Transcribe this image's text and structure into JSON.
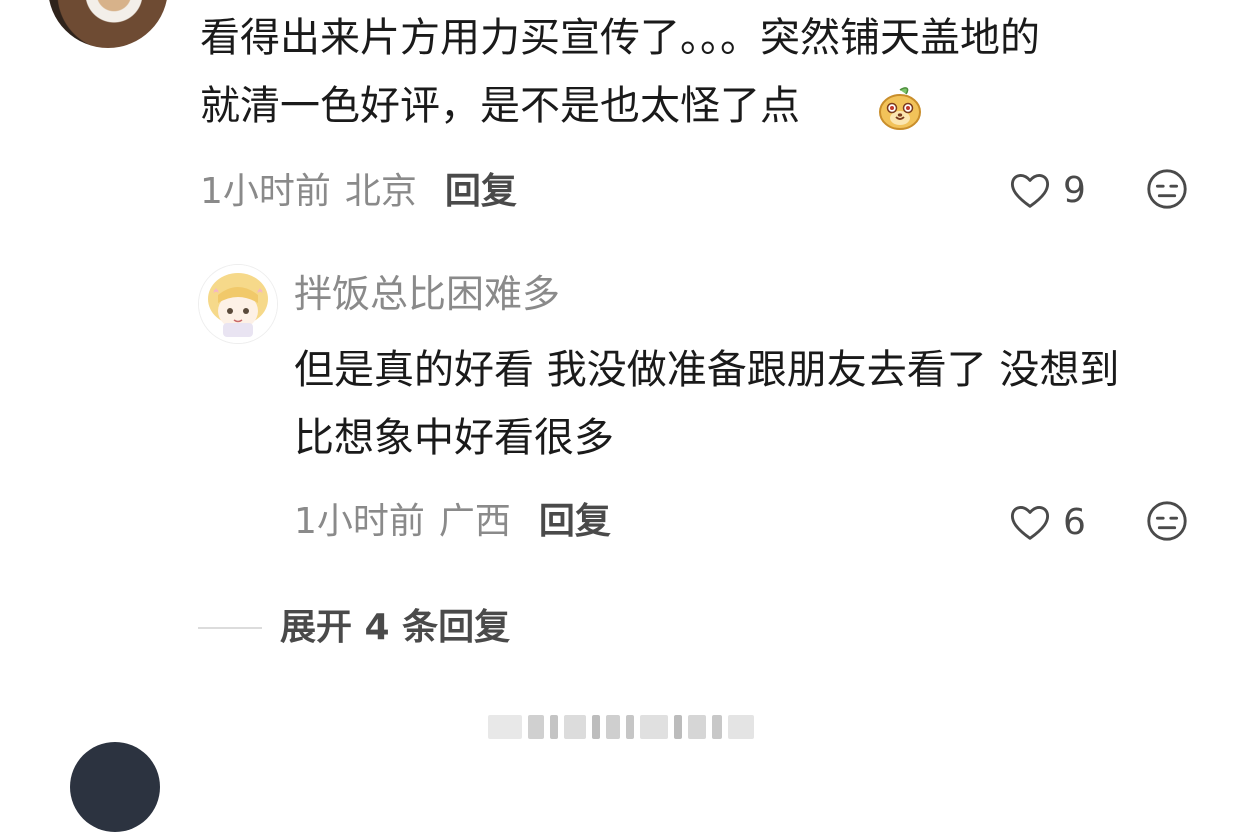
{
  "comment": {
    "text": "看得出来片方用力买宣传了。。。突然铺天盖地的\n就清一色好评，是不是也太怪了点",
    "time": "1小时前",
    "location": "北京",
    "reply_label": "回复",
    "like_count": "9",
    "emoji_icon": "fox-face-emoji",
    "like_icon": "heart-outline-icon",
    "dislike_icon": "meh-face-icon"
  },
  "reply": {
    "username": "拌饭总比困难多",
    "text": "但是真的好看 我没做准备跟朋友去看了 没想到\n比想象中好看很多",
    "time": "1小时前",
    "location": "广西",
    "reply_label": "回复",
    "like_count": "6"
  },
  "expand": {
    "label": "展开 4 条回复"
  },
  "colors": {
    "text": "#1a1a1a",
    "meta": "#8a8a8a",
    "action": "#4a4a4a"
  }
}
